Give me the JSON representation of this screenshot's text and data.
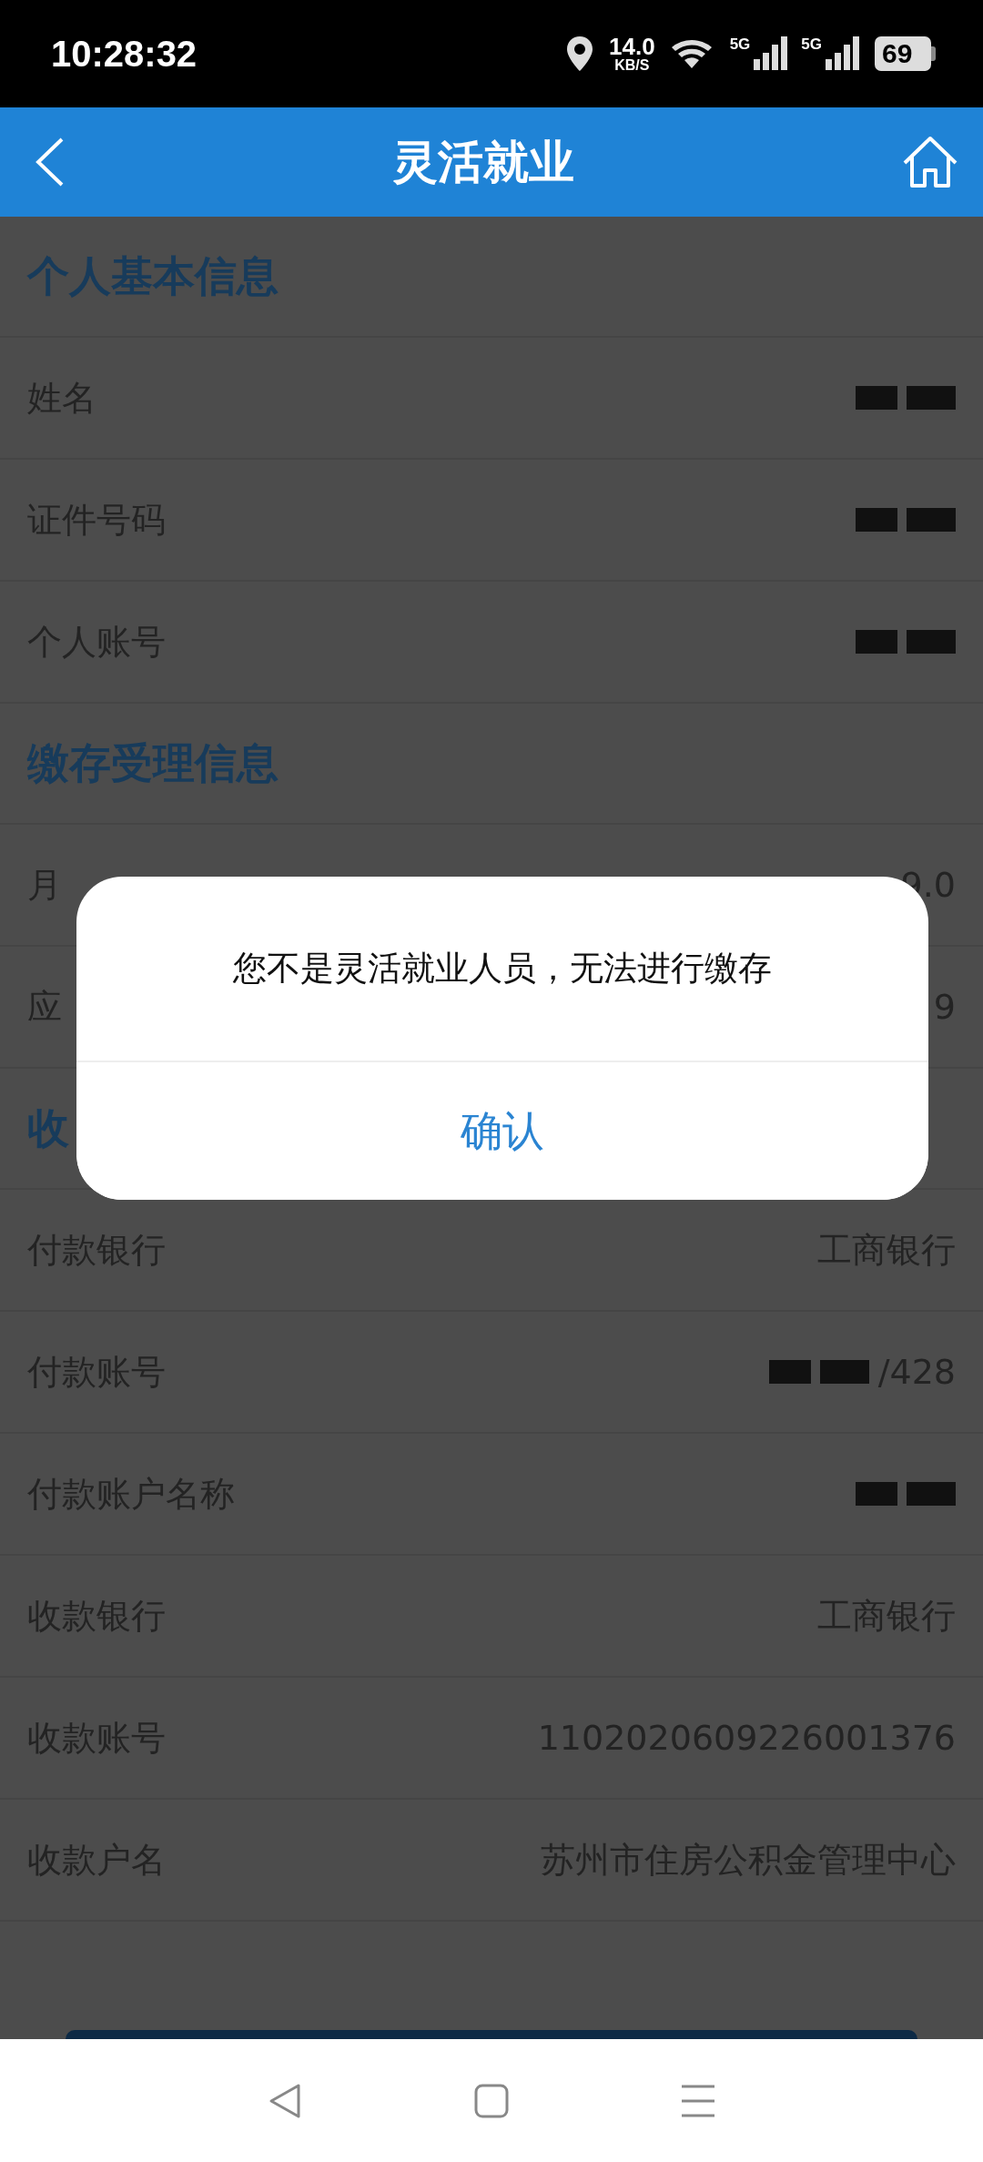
{
  "status_bar": {
    "time": "10:28:32",
    "speed": "14.0",
    "speed_unit": "KB/S",
    "networks": [
      "5G",
      "5G"
    ],
    "battery": "69"
  },
  "header": {
    "title": "灵活就业"
  },
  "sections": [
    {
      "title": "个人基本信息",
      "rows": [
        {
          "kind": "masked",
          "label": "姓名"
        },
        {
          "kind": "masked",
          "label": "证件号码"
        },
        {
          "kind": "masked",
          "label": "个人账号"
        }
      ]
    },
    {
      "title": "缴存受理信息",
      "rows": [
        {
          "kind": "text",
          "label": "月",
          "value": "9.0"
        },
        {
          "kind": "text",
          "label": "应",
          "value": "9"
        }
      ]
    },
    {
      "title": "收",
      "rows": [
        {
          "kind": "text",
          "label": "付款银行",
          "value": "工商银行"
        },
        {
          "kind": "masked",
          "label": "付款账号",
          "value": "/428"
        },
        {
          "kind": "masked",
          "label": "付款账户名称"
        },
        {
          "kind": "text",
          "label": "收款银行",
          "value": "工商银行"
        },
        {
          "kind": "text",
          "label": "收款账号",
          "value": "1102020609226001376"
        },
        {
          "kind": "text",
          "label": "收款户名",
          "value": "苏州市住房公积金管理中心"
        }
      ]
    }
  ],
  "dialog": {
    "message": "您不是灵活就业人员，无法进行缴存",
    "button": "确认"
  }
}
